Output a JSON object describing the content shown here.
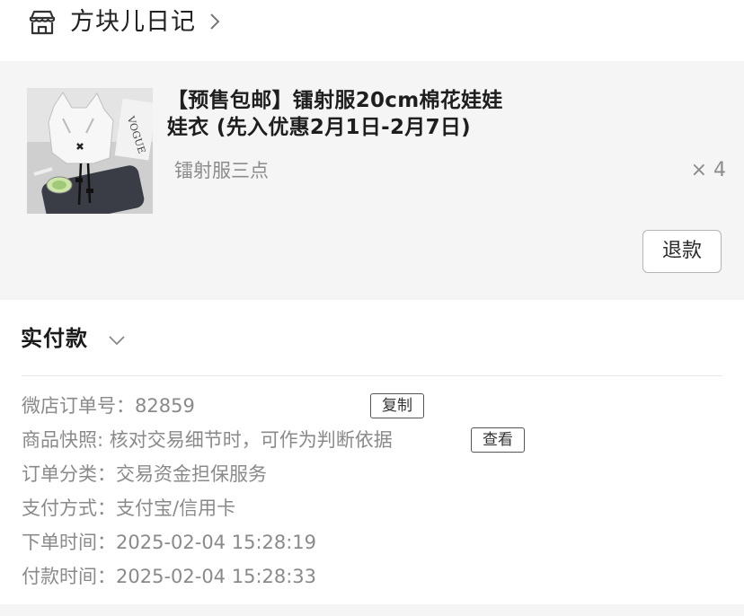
{
  "shop": {
    "name": "方块儿日记",
    "icon": "storefront-icon",
    "chevron_icon": "chevron-right-icon"
  },
  "item": {
    "title": "【预售包邮】镭射服20cm棉花娃娃\n娃衣 (先入优惠2月1日-2月7日)",
    "spec": "镭射服三点",
    "quantity": "× 4",
    "refund_label": "退款",
    "thumbnail": "product-photo"
  },
  "summary": {
    "paid_label": "实付款",
    "paid_chevron_icon": "chevron-down-icon",
    "order_no": "微店订单号：82859",
    "copy_label": "复制",
    "snapshot": "商品快照: 核对交易细节时，可作为判断依据",
    "view_label": "查看",
    "category": "订单分类：交易资金担保服务",
    "payment": "支付方式：支付宝/信用卡",
    "order_time": "下单时间：2025-02-04 15:28:19",
    "pay_time": "付款时间：2025-02-04 15:28:33"
  },
  "colors": {
    "card_bg": "#f5f5f5",
    "text_primary": "#222222",
    "text_secondary": "#8a8a8a"
  }
}
